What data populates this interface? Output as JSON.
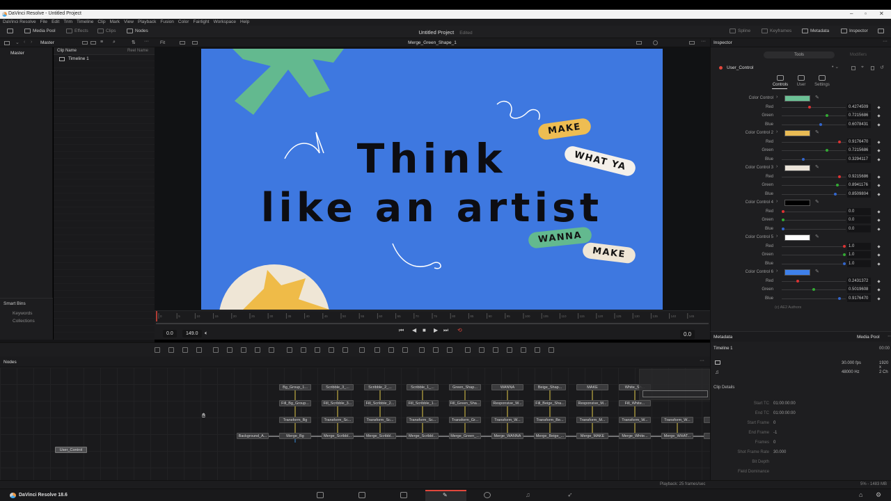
{
  "window": {
    "title": "DaVinci Resolve - Untitled Project"
  },
  "menu": [
    "DaVinci Resolve",
    "File",
    "Edit",
    "Trim",
    "Timeline",
    "Clip",
    "Mark",
    "View",
    "Playback",
    "Fusion",
    "Color",
    "Fairlight",
    "Workspace",
    "Help"
  ],
  "toolbar": {
    "media_pool": "Media Pool",
    "effects": "Effects",
    "clips": "Clips",
    "nodes": "Nodes",
    "project_title": "Untitled Project",
    "project_state": "Edited",
    "spline": "Spline",
    "keyframes": "Keyframes",
    "metadata": "Metadata",
    "inspector": "Inspector"
  },
  "media_pool": {
    "bin_header": "Master",
    "bin_root": "Master",
    "col_clip_name": "Clip Name",
    "col_reel_name": "Reel Name",
    "items": [
      "Timeline 1"
    ],
    "smart_bins": "Smart Bins",
    "keywords": "Keywords",
    "collections": "Collections"
  },
  "viewer": {
    "zoom_label": "Fit",
    "clip_name": "Merge_Green_Shape_1",
    "canvas": {
      "line1": "Think",
      "line2": "like an artist",
      "pill_make1": "MAKE",
      "pill_whatya": "WHAT YA",
      "pill_wanna": "WANNA",
      "pill_make2": "MAKE"
    },
    "ruler_ticks": [
      "0",
      "5",
      "10",
      "15",
      "20",
      "25",
      "30",
      "35",
      "40",
      "45",
      "50",
      "55",
      "60",
      "65",
      "70",
      "75",
      "80",
      "85",
      "90",
      "95",
      "100",
      "105",
      "110",
      "115",
      "120",
      "125",
      "130",
      "135",
      "140",
      "145"
    ],
    "range_start": "0.0",
    "range_end": "149.0",
    "current_frame": "0.0"
  },
  "inspector": {
    "title": "Inspector",
    "tab_tools": "Tools",
    "tab_modifiers": "Modifiers",
    "node_name": "User_Control",
    "subtabs": [
      "Controls",
      "User",
      "Settings"
    ],
    "color_controls": [
      {
        "label": "Color Control",
        "swatch": "#6cc095",
        "red": "0.4274509",
        "green": "0.7215686",
        "blue": "0.6078431",
        "r": 0.43,
        "g": 0.72,
        "b": 0.61
      },
      {
        "label": "Color Control 2",
        "swatch": "#e9bb54",
        "red": "0.9176470",
        "green": "0.7215686",
        "blue": "0.3294117",
        "r": 0.92,
        "g": 0.72,
        "b": 0.33
      },
      {
        "label": "Color Control 3",
        "swatch": "#ebe4d9",
        "red": "0.9215686",
        "green": "0.8941176",
        "blue": "0.8509804",
        "r": 0.92,
        "g": 0.89,
        "b": 0.85
      },
      {
        "label": "Color Control 4",
        "swatch": "#000000",
        "red": "0.0",
        "green": "0.0",
        "blue": "0.0",
        "r": 0.0,
        "g": 0.0,
        "b": 0.0
      },
      {
        "label": "Color Control 5",
        "swatch": "#ffffff",
        "red": "1.0",
        "green": "1.0",
        "blue": "1.0",
        "r": 1.0,
        "g": 1.0,
        "b": 1.0
      },
      {
        "label": "Color Control 6",
        "swatch": "#3e80ea",
        "red": "0.2431372",
        "green": "0.5019608",
        "blue": "0.9176470",
        "r": 0.24,
        "g": 0.5,
        "b": 0.92
      }
    ],
    "channel_labels": {
      "red": "Red",
      "green": "Green",
      "blue": "Blue"
    },
    "authors": "(c) AE2 Authors"
  },
  "metadata": {
    "title": "Metadata",
    "media_pool": "Media Pool",
    "timeline": "Timeline 1",
    "tc_short": "00:00",
    "fps": "30.000 fps",
    "res": "1920 x",
    "audio_hz": "48000 Hz",
    "audio_ch": "2 Ch",
    "clip_details": "Clip Details",
    "fields": [
      {
        "label": "Start TC",
        "value": "01:00:00:00"
      },
      {
        "label": "End TC",
        "value": "01:00:00:00"
      },
      {
        "label": "Start Frame",
        "value": "0"
      },
      {
        "label": "End Frame",
        "value": "-1"
      },
      {
        "label": "Frames",
        "value": "0"
      },
      {
        "label": "Shot Frame Rate",
        "value": "30.000"
      },
      {
        "label": "Bit Depth",
        "value": ""
      },
      {
        "label": "Field Dominance",
        "value": ""
      }
    ]
  },
  "nodes": {
    "title": "Nodes",
    "row1": [
      "Bg_Group_1...",
      "Scribble_3_...",
      "Scribble_2_...",
      "Scribble_1_...",
      "Green_Shap...",
      "WANNA",
      "Beige_Shap...",
      "MAKE",
      "White_Sh..."
    ],
    "row2": [
      "Fill_Bg_Group...",
      "Fill_Scribble_3...",
      "Fill_Scribble_2...",
      "Fill_Scribble_1...",
      "Fill_Green_Sha...",
      "Responsive_W...",
      "Fill_Beige_Sha...",
      "Responsive_M...",
      "Fill_White..."
    ],
    "row3": [
      "Transform_Bg",
      "Transform_Sc...",
      "Transform_Sc...",
      "Transform_Sc...",
      "Transform_Gr...",
      "Transform_W...",
      "Transform_Be...",
      "Transform_M...",
      "Transform_W...",
      "Transform_W...",
      "Tr"
    ],
    "row4": [
      "Background_A...",
      "Merge_Bg",
      "Merge_Scribbl...",
      "Merge_Scribbl...",
      "Merge_Scribbl...",
      "Merge_Green_...",
      "Merge_WANNA",
      "Merge_Beige_...",
      "Merge_MAKE",
      "Merge_White...",
      "Merge_WHAT...",
      "M"
    ],
    "user_control": "User_Control"
  },
  "status": {
    "playback": "Playback: 25 frames/sec",
    "memory": "5% - 1483 MB"
  },
  "app_footer": {
    "name": "DaVinci Resolve 18.6"
  }
}
